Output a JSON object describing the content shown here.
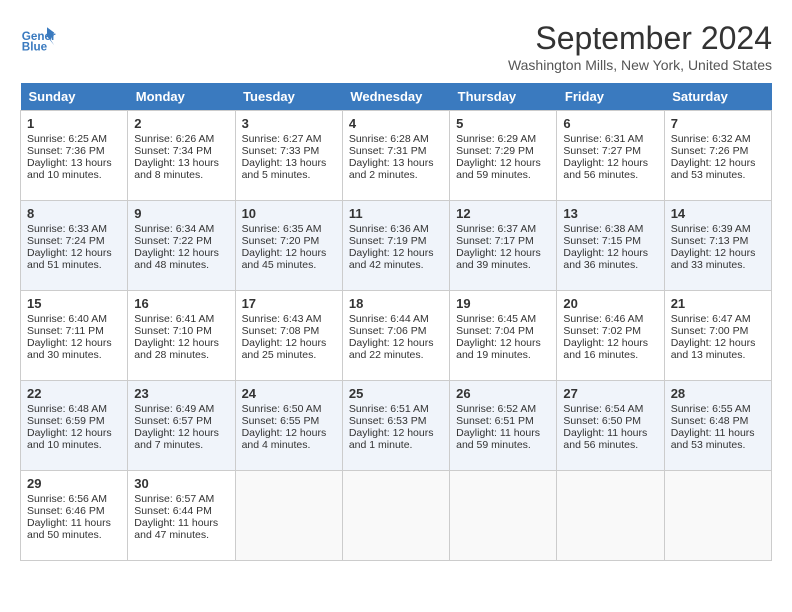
{
  "header": {
    "logo_line1": "General",
    "logo_line2": "Blue",
    "month": "September 2024",
    "location": "Washington Mills, New York, United States"
  },
  "weekdays": [
    "Sunday",
    "Monday",
    "Tuesday",
    "Wednesday",
    "Thursday",
    "Friday",
    "Saturday"
  ],
  "weeks": [
    [
      {
        "day": "1",
        "lines": [
          "Sunrise: 6:25 AM",
          "Sunset: 7:36 PM",
          "Daylight: 13 hours",
          "and 10 minutes."
        ]
      },
      {
        "day": "2",
        "lines": [
          "Sunrise: 6:26 AM",
          "Sunset: 7:34 PM",
          "Daylight: 13 hours",
          "and 8 minutes."
        ]
      },
      {
        "day": "3",
        "lines": [
          "Sunrise: 6:27 AM",
          "Sunset: 7:33 PM",
          "Daylight: 13 hours",
          "and 5 minutes."
        ]
      },
      {
        "day": "4",
        "lines": [
          "Sunrise: 6:28 AM",
          "Sunset: 7:31 PM",
          "Daylight: 13 hours",
          "and 2 minutes."
        ]
      },
      {
        "day": "5",
        "lines": [
          "Sunrise: 6:29 AM",
          "Sunset: 7:29 PM",
          "Daylight: 12 hours",
          "and 59 minutes."
        ]
      },
      {
        "day": "6",
        "lines": [
          "Sunrise: 6:31 AM",
          "Sunset: 7:27 PM",
          "Daylight: 12 hours",
          "and 56 minutes."
        ]
      },
      {
        "day": "7",
        "lines": [
          "Sunrise: 6:32 AM",
          "Sunset: 7:26 PM",
          "Daylight: 12 hours",
          "and 53 minutes."
        ]
      }
    ],
    [
      {
        "day": "8",
        "lines": [
          "Sunrise: 6:33 AM",
          "Sunset: 7:24 PM",
          "Daylight: 12 hours",
          "and 51 minutes."
        ]
      },
      {
        "day": "9",
        "lines": [
          "Sunrise: 6:34 AM",
          "Sunset: 7:22 PM",
          "Daylight: 12 hours",
          "and 48 minutes."
        ]
      },
      {
        "day": "10",
        "lines": [
          "Sunrise: 6:35 AM",
          "Sunset: 7:20 PM",
          "Daylight: 12 hours",
          "and 45 minutes."
        ]
      },
      {
        "day": "11",
        "lines": [
          "Sunrise: 6:36 AM",
          "Sunset: 7:19 PM",
          "Daylight: 12 hours",
          "and 42 minutes."
        ]
      },
      {
        "day": "12",
        "lines": [
          "Sunrise: 6:37 AM",
          "Sunset: 7:17 PM",
          "Daylight: 12 hours",
          "and 39 minutes."
        ]
      },
      {
        "day": "13",
        "lines": [
          "Sunrise: 6:38 AM",
          "Sunset: 7:15 PM",
          "Daylight: 12 hours",
          "and 36 minutes."
        ]
      },
      {
        "day": "14",
        "lines": [
          "Sunrise: 6:39 AM",
          "Sunset: 7:13 PM",
          "Daylight: 12 hours",
          "and 33 minutes."
        ]
      }
    ],
    [
      {
        "day": "15",
        "lines": [
          "Sunrise: 6:40 AM",
          "Sunset: 7:11 PM",
          "Daylight: 12 hours",
          "and 30 minutes."
        ]
      },
      {
        "day": "16",
        "lines": [
          "Sunrise: 6:41 AM",
          "Sunset: 7:10 PM",
          "Daylight: 12 hours",
          "and 28 minutes."
        ]
      },
      {
        "day": "17",
        "lines": [
          "Sunrise: 6:43 AM",
          "Sunset: 7:08 PM",
          "Daylight: 12 hours",
          "and 25 minutes."
        ]
      },
      {
        "day": "18",
        "lines": [
          "Sunrise: 6:44 AM",
          "Sunset: 7:06 PM",
          "Daylight: 12 hours",
          "and 22 minutes."
        ]
      },
      {
        "day": "19",
        "lines": [
          "Sunrise: 6:45 AM",
          "Sunset: 7:04 PM",
          "Daylight: 12 hours",
          "and 19 minutes."
        ]
      },
      {
        "day": "20",
        "lines": [
          "Sunrise: 6:46 AM",
          "Sunset: 7:02 PM",
          "Daylight: 12 hours",
          "and 16 minutes."
        ]
      },
      {
        "day": "21",
        "lines": [
          "Sunrise: 6:47 AM",
          "Sunset: 7:00 PM",
          "Daylight: 12 hours",
          "and 13 minutes."
        ]
      }
    ],
    [
      {
        "day": "22",
        "lines": [
          "Sunrise: 6:48 AM",
          "Sunset: 6:59 PM",
          "Daylight: 12 hours",
          "and 10 minutes."
        ]
      },
      {
        "day": "23",
        "lines": [
          "Sunrise: 6:49 AM",
          "Sunset: 6:57 PM",
          "Daylight: 12 hours",
          "and 7 minutes."
        ]
      },
      {
        "day": "24",
        "lines": [
          "Sunrise: 6:50 AM",
          "Sunset: 6:55 PM",
          "Daylight: 12 hours",
          "and 4 minutes."
        ]
      },
      {
        "day": "25",
        "lines": [
          "Sunrise: 6:51 AM",
          "Sunset: 6:53 PM",
          "Daylight: 12 hours",
          "and 1 minute."
        ]
      },
      {
        "day": "26",
        "lines": [
          "Sunrise: 6:52 AM",
          "Sunset: 6:51 PM",
          "Daylight: 11 hours",
          "and 59 minutes."
        ]
      },
      {
        "day": "27",
        "lines": [
          "Sunrise: 6:54 AM",
          "Sunset: 6:50 PM",
          "Daylight: 11 hours",
          "and 56 minutes."
        ]
      },
      {
        "day": "28",
        "lines": [
          "Sunrise: 6:55 AM",
          "Sunset: 6:48 PM",
          "Daylight: 11 hours",
          "and 53 minutes."
        ]
      }
    ],
    [
      {
        "day": "29",
        "lines": [
          "Sunrise: 6:56 AM",
          "Sunset: 6:46 PM",
          "Daylight: 11 hours",
          "and 50 minutes."
        ]
      },
      {
        "day": "30",
        "lines": [
          "Sunrise: 6:57 AM",
          "Sunset: 6:44 PM",
          "Daylight: 11 hours",
          "and 47 minutes."
        ]
      },
      {
        "day": "",
        "lines": []
      },
      {
        "day": "",
        "lines": []
      },
      {
        "day": "",
        "lines": []
      },
      {
        "day": "",
        "lines": []
      },
      {
        "day": "",
        "lines": []
      }
    ]
  ]
}
